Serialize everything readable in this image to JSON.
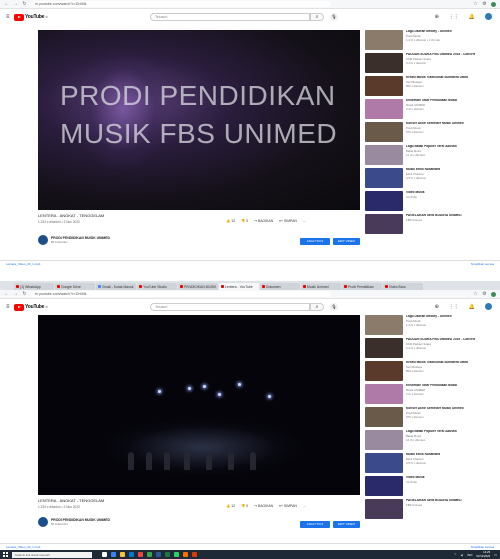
{
  "screenshot1": {
    "url": "m.youtube.com/watch?v=Dr4Mk",
    "yt": {
      "logo": "YouTube",
      "logo_cc": "ID",
      "search_placeholder": "Telusuri"
    },
    "video": {
      "overlay_line1": "PRODI PENDIDIKAN",
      "overlay_line2": "MUSIK FBS UNIMED",
      "title": "LENTERA - ANGKAT - TENGGELAM",
      "meta": "1.234 x ditonton • 2 Nov 2020",
      "actions": {
        "like": "12",
        "dislike": "0",
        "share": "BAGIKAN",
        "save": "SIMPAN",
        "more": "..."
      },
      "channel_name": "PRODI PENDIDIKAN MUSIK UNIMED",
      "channel_subs": "89 subscriber",
      "join_button": "ANALYTICS",
      "subscribe_button": "EDIT VIDEO"
    },
    "recommendations": [
      {
        "title": "Lagu Daerah Medley - Unimed",
        "sub1": "Prodi Musik",
        "sub2": "1,2 rb x ditonton • 1 thn lalu",
        "color": "#8a7b6a"
      },
      {
        "title": "PADUAN SUARA FBS UNIMED 2019 - Concert",
        "sub1": "UKM Paduan Suara",
        "sub2": "3,4 rb x ditonton",
        "color": "#3a2f2a"
      },
      {
        "title": "Kreasi Musik Tradisional Sumatera Utara",
        "sub1": "Seni Budaya",
        "sub2": "850 x ditonton",
        "color": "#5a3a2a"
      },
      {
        "title": "Ensemble Gitar Pendidikan Musik",
        "sub1": "Musik UNIMED",
        "sub2": "2 rb x ditonton",
        "color": "#b07aa8"
      },
      {
        "title": "Konser Akhir Semester Musik Unimed",
        "sub1": "Prodi Musik",
        "sub2": "970 x ditonton",
        "color": "#6a5a4a"
      },
      {
        "title": "Lagu Batak Populer Versi Akustik",
        "sub1": "Batak Music",
        "sub2": "12 rb x ditonton",
        "color": "#9a8aa0"
      },
      {
        "title": "Musik Etnik Nusantara",
        "sub1": "Etnik Channel",
        "sub2": "4,5 rb x ditonton",
        "color": "#3a4a8a"
      },
      {
        "title": "Video Musik",
        "sub1": "YouTube",
        "sub2": "",
        "color": "#2a2a6a"
      },
      {
        "title": "PAGELARAN SENI BUDAYA UNIMED",
        "sub1": "FBS Unimed",
        "sub2": "",
        "color": "#4a3a5a"
      }
    ],
    "download_left": "Lentera_Video_20_1.mp4",
    "download_right": "Tampilkan semua"
  },
  "screenshot2": {
    "tabs": [
      "(1) WhatsApp",
      "Google Drive",
      "Gmail - Kotak Masuk",
      "YouTube Studio",
      "PENDIDIKAN MUSIK",
      "Lentera - YouTube",
      "Dokumen",
      "Musik Unimed",
      "Prodi Pendidikan",
      "Video Baru"
    ],
    "url": "m.youtube.com/watch?v=Dr4Mk",
    "yt": {
      "logo": "YouTube",
      "logo_cc": "ID",
      "search_placeholder": "Telusuri"
    },
    "video": {
      "title": "LENTERA - ANGKAT - TENGGELAM",
      "meta": "1.234 x ditonton • 2 Nov 2020",
      "actions": {
        "like": "12",
        "dislike": "0",
        "share": "BAGIKAN",
        "save": "SIMPAN",
        "more": "..."
      },
      "channel_name": "PRODI PENDIDIKAN MUSIK UNIMED",
      "channel_subs": "89 subscriber",
      "join_button": "ANALYTICS",
      "subscribe_button": "EDIT VIDEO"
    },
    "recommendations": [
      {
        "title": "Lagu Daerah Medley - Unimed",
        "sub1": "Prodi Musik",
        "sub2": "1,2 rb x ditonton",
        "color": "#8a7b6a"
      },
      {
        "title": "PADUAN SUARA FBS UNIMED 2019 - Concert",
        "sub1": "UKM Paduan Suara",
        "sub2": "3,4 rb x ditonton",
        "color": "#3a2f2a"
      },
      {
        "title": "Kreasi Musik Tradisional Sumatera Utara",
        "sub1": "Seni Budaya",
        "sub2": "850 x ditonton",
        "color": "#5a3a2a"
      },
      {
        "title": "Ensemble Gitar Pendidikan Musik",
        "sub1": "Musik UNIMED",
        "sub2": "2 rb x ditonton",
        "color": "#b07aa8"
      },
      {
        "title": "Konser Akhir Semester Musik Unimed",
        "sub1": "Prodi Musik",
        "sub2": "970 x ditonton",
        "color": "#6a5a4a"
      },
      {
        "title": "Lagu Batak Populer Versi Akustik",
        "sub1": "Batak Music",
        "sub2": "12 rb x ditonton",
        "color": "#9a8aa0"
      },
      {
        "title": "Musik Etnik Nusantara",
        "sub1": "Etnik Channel",
        "sub2": "4,5 rb x ditonton",
        "color": "#3a4a8a"
      },
      {
        "title": "Video Musik",
        "sub1": "YouTube",
        "sub2": "",
        "color": "#2a2a6a"
      },
      {
        "title": "PAGELARAN SENI BUDAYA UNIMED",
        "sub1": "FBS Unimed",
        "sub2": "",
        "color": "#4a3a5a"
      }
    ],
    "download_left": "Lentera_Video_20_1.mp4",
    "download_right": "Tampilkan semua",
    "taskbar": {
      "search_placeholder": "Ketik di sini untuk mencari",
      "time": "14:25",
      "date": "02/11/2020",
      "lang": "IND"
    }
  },
  "colors": {
    "youtube_red": "#ff0000",
    "button_blue": "#1a73e8",
    "taskbar": "#1e2a36"
  }
}
